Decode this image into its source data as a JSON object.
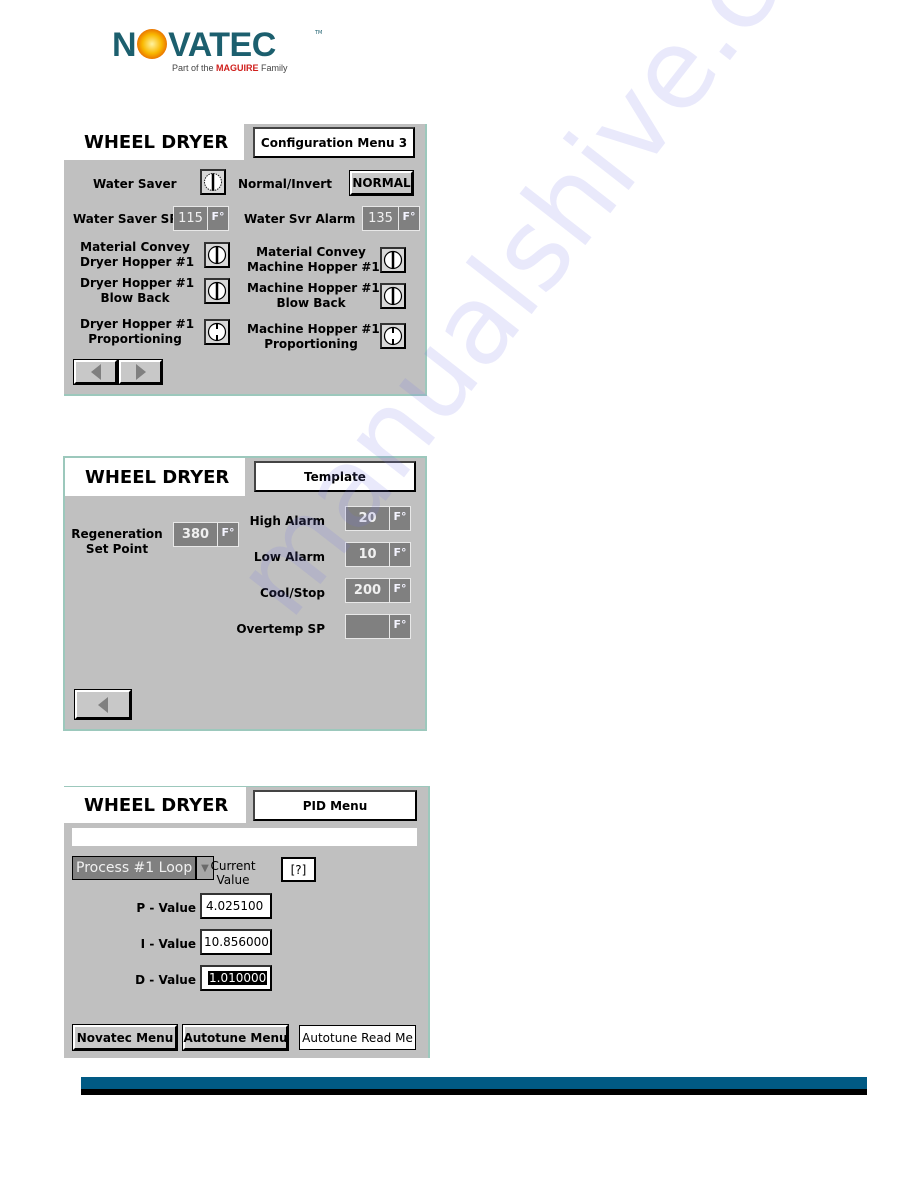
{
  "logo": {
    "brand_prefix": "N",
    "brand_suffix": "VATEC",
    "trademark": "TM",
    "tagline_pre": "Part of the ",
    "tagline_brand": "MAGUIRE",
    "tagline_post": " Family"
  },
  "colors": {
    "brand_teal": "#1c5f6e",
    "panel_gray": "#c0c0c0",
    "field_gray": "#808080",
    "footer_blue": "#015a84",
    "maguire_red": "#d0201d"
  },
  "config_panel": {
    "title": "WHEEL DRYER",
    "menu_title": "Configuration Menu 3",
    "water_saver_label": "Water Saver",
    "normal_invert_label": "Normal/Invert",
    "normal_invert_button": "NORMAL",
    "water_saver_sp_label": "Water Saver SP",
    "water_saver_sp_value": "115",
    "water_saver_sp_unit": "F°",
    "water_svr_alarm_label": "Water Svr Alarm",
    "water_svr_alarm_value": "135",
    "water_svr_alarm_unit": "F°",
    "toggles_left": [
      {
        "line1": "Material Convey",
        "line2": "Dryer Hopper #1",
        "state": "open"
      },
      {
        "line1": "Dryer Hopper #1",
        "line2": "Blow Back",
        "state": "open"
      },
      {
        "line1": "Dryer Hopper #1",
        "line2": "Proportioning",
        "state": "closed"
      }
    ],
    "toggles_right": [
      {
        "line1": "Material Convey",
        "line2": "Machine Hopper #1",
        "state": "open"
      },
      {
        "line1": "Machine Hopper #1",
        "line2": "Blow Back",
        "state": "open"
      },
      {
        "line1": "Machine Hopper #1",
        "line2": "Proportioning",
        "state": "closed"
      }
    ],
    "water_saver_state": "open-hatched"
  },
  "template_panel": {
    "title": "WHEEL DRYER",
    "menu_title": "Template",
    "regen_label_line1": "Regeneration",
    "regen_label_line2": "Set Point",
    "regen_value": "380",
    "unit": "F°",
    "high_alarm_label": "High Alarm",
    "high_alarm_value": "20",
    "low_alarm_label": "Low Alarm",
    "low_alarm_value": "10",
    "cool_stop_label": "Cool/Stop",
    "cool_stop_value": "200",
    "overtemp_label": "Overtemp SP",
    "overtemp_value": ""
  },
  "pid_panel": {
    "title": "WHEEL DRYER",
    "menu_title": "PID Menu",
    "status_text": "",
    "loop_select_value": "Process #1 Loop",
    "current_value_label_line1": "Current",
    "current_value_label_line2": "Value",
    "current_value": "[?]",
    "p_label": "P - Value",
    "p_value": "4.025100",
    "i_label": "I - Value",
    "i_value": "10.856000",
    "d_label": "D - Value",
    "d_value": "1.010000",
    "buttons": {
      "novatec_menu": "Novatec Menu",
      "autotune_menu": "Autotune Menu",
      "autotune_read_me": "Autotune Read Me"
    }
  },
  "watermark": "manualshive.com"
}
